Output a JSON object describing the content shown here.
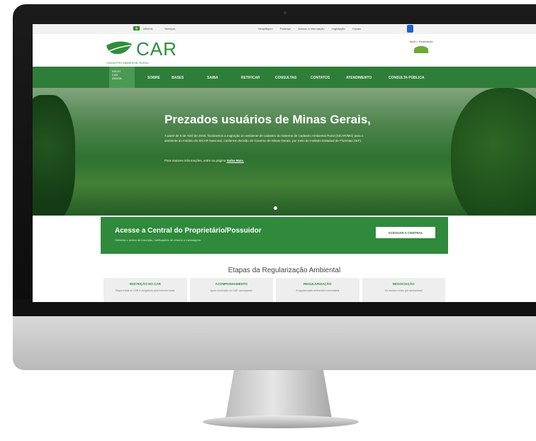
{
  "gov_bar": {
    "country": "BRASIL",
    "services": "Serviços",
    "links": [
      "Simplifique!",
      "Participe",
      "Acesso à informação",
      "Legislação",
      "Canais"
    ]
  },
  "header": {
    "logo_text": "CAR",
    "logo_subtitle": "CADASTRO AMBIENTAL RURAL",
    "support_label": "Apoio / Realização"
  },
  "nav": {
    "home_label": "INÍCIO",
    "home_sub": "CAR\nBRASIL",
    "items": [
      "SOBRE",
      "BASES",
      "SAIBA",
      "RETIFICAR",
      "CONSULTAS",
      "CONTATOS",
      "ATENDIMENTO",
      "CONSULTA PÚBLICA"
    ]
  },
  "hero": {
    "title": "Prezados usuários de Minas Gerais,",
    "body": "A partir de 6 de Abril de 2018, finalizamos a migração do ambiente de cadastro do Sistema de Cadastro Ambiental Rural (SICAR/MG) para o ambiente do módulo de SICAR Nacional, conforme decisão do Governo de Minas Gerais, por meio do Instituto Estadual de Florestas (IEF).",
    "more_prefix": "Para maiores informações, entre na página",
    "more_link": "Saiba Mais."
  },
  "central": {
    "title": "Acesse a Central do Proprietário/Possuidor",
    "description": "Obtenha o recibo de inscrição, notificações de retorno e mensagens.",
    "button": "ACESSAR A CENTRAL"
  },
  "etapas": {
    "title": "Etapas da Regularização Ambiental",
    "items": [
      {
        "title": "INSCRIÇÃO NO CAR",
        "desc": "Etapa inicial no CAR é obrigatória para imóveis rurais"
      },
      {
        "title": "ACOMPANHAMENTO",
        "desc": "Após a inscrição no CAR, acompanhe"
      },
      {
        "title": "REGULARIZAÇÃO",
        "desc": "A regularização ambiental é necessária"
      },
      {
        "title": "NEGOCIAÇÃO",
        "desc": "Os imóveis rurais que apresentam"
      }
    ]
  },
  "colors": {
    "brand_green": "#2f8e3c",
    "nav_green": "#2e7d38",
    "box_green": "#2f8a3c"
  }
}
